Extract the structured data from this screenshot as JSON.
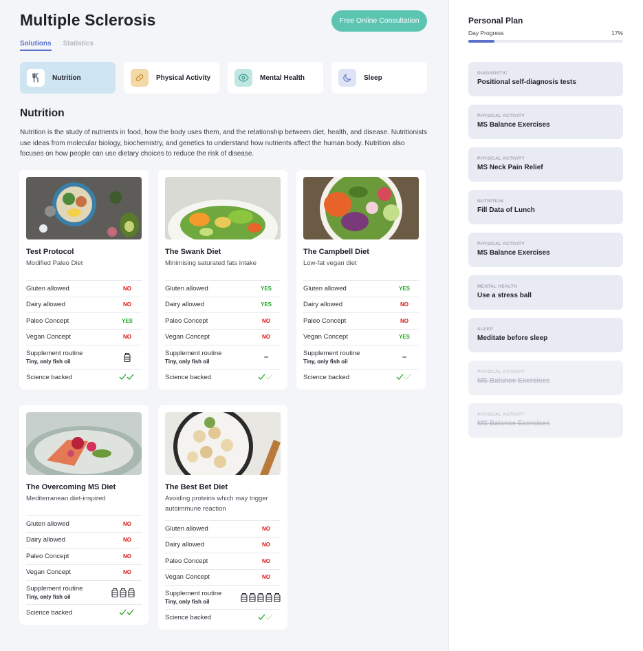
{
  "page_title": "Multiple Sclerosis",
  "consult_button": "Free Online Consultation",
  "tabs": [
    {
      "label": "Solutions",
      "active": true
    },
    {
      "label": "Statistics",
      "active": false
    }
  ],
  "categories": [
    {
      "label": "Nutrition",
      "icon": "fork-knife-icon",
      "color": "#cfe5f2"
    },
    {
      "label": "Physical Activity",
      "icon": "bandage-icon",
      "color": "#f3d8a8"
    },
    {
      "label": "Mental Health",
      "icon": "eye-icon",
      "color": "#bfe6e0"
    },
    {
      "label": "Sleep",
      "icon": "moon-icon",
      "color": "#dfe3f6"
    }
  ],
  "section": {
    "title": "Nutrition",
    "text": "Nutrition is the study of nutrients in food, how the body uses them, and the relationship between diet, health, and disease. Nutritionists use ideas from molecular biology, biochemistry, and genetics to understand how nutrients affect the human body. Nutrition also focuses on how people can use dietary choices to reduce the risk of disease."
  },
  "row_labels": {
    "gluten": "Gluten allowed",
    "dairy": "Dairy allowed",
    "paleo": "Paleo Concept",
    "vegan": "Vegan Concept",
    "supplement": "Supplement routine",
    "supplement_sub": "Tiny, only fish oil",
    "science": "Science backed"
  },
  "diets": [
    {
      "name": "Test Protocol",
      "subtitle": "Modified Paleo Diet",
      "gluten": "NO",
      "dairy": "NO",
      "paleo": "YES",
      "vegan": "NO",
      "supplement_jars": 1,
      "science_checks": 2
    },
    {
      "name": "The Swank Diet",
      "subtitle": "Minimising saturated fats intake",
      "gluten": "YES",
      "dairy": "YES",
      "paleo": "NO",
      "vegan": "NO",
      "supplement_jars": 0,
      "science_checks": 1
    },
    {
      "name": "The Campbell Diet",
      "subtitle": "Low-fat vegan diet",
      "gluten": "YES",
      "dairy": "NO",
      "paleo": "NO",
      "vegan": "YES",
      "supplement_jars": 0,
      "science_checks": 1
    },
    {
      "name": "The Overcoming MS Diet",
      "subtitle": "Mediterranean diet-inspired",
      "gluten": "NO",
      "dairy": "NO",
      "paleo": "NO",
      "vegan": "NO",
      "supplement_jars": 3,
      "science_checks": 2
    },
    {
      "name": "The Best Bet Diet",
      "subtitle": "Avoiding proteins which may trigger autoimmune reaction",
      "gluten": "NO",
      "dairy": "NO",
      "paleo": "NO",
      "vegan": "NO",
      "supplement_jars": 5,
      "science_checks": 1
    }
  ],
  "dash": "–",
  "plan": {
    "title": "Personal Plan",
    "progress_label": "Day Progress",
    "progress_text": "17%",
    "progress": 0.17,
    "tasks": [
      {
        "category": "DIAGNOSTIC",
        "name": "Positional self-diagnosis tests",
        "done": false
      },
      {
        "category": "PHYSICAL ACTIVITY",
        "name": "MS Balance Exercises",
        "done": false
      },
      {
        "category": "PHYSICAL ACTIVITY",
        "name": "MS Neck Pain Relief",
        "done": false
      },
      {
        "category": "NUTRITION",
        "name": "Fill Data of Lunch",
        "done": false
      },
      {
        "category": "PHYSICAL ACTIVITY",
        "name": "MS Balance Exercises",
        "done": false
      },
      {
        "category": "MENTAL HEALTH",
        "name": "Use a stress ball",
        "done": false
      },
      {
        "category": "SLEEP",
        "name": "Meditate before sleep",
        "done": false
      },
      {
        "category": "PHYSICAL ACTIVITY",
        "name": "MS Balance Exercises",
        "done": true
      },
      {
        "category": "PHYSICAL ACTIVITY",
        "name": "MS Balance Exercises",
        "done": true
      }
    ]
  }
}
